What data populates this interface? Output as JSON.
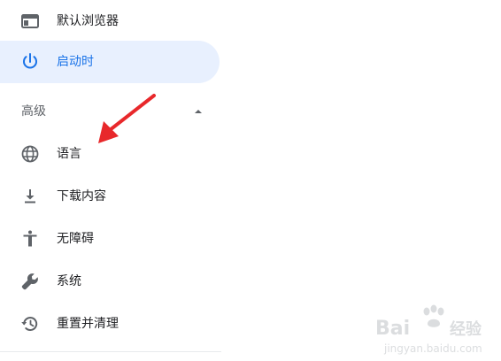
{
  "sidebar": {
    "items": [
      {
        "label": "默认浏览器",
        "icon": "browser-window-icon"
      },
      {
        "label": "启动时",
        "icon": "power-icon",
        "active": true
      },
      {
        "label": "语言",
        "icon": "globe-icon"
      },
      {
        "label": "下载内容",
        "icon": "download-icon"
      },
      {
        "label": "无障碍",
        "icon": "accessibility-icon"
      },
      {
        "label": "系统",
        "icon": "wrench-icon"
      },
      {
        "label": "重置并清理",
        "icon": "reset-history-icon"
      }
    ],
    "advanced_section": {
      "label": "高级",
      "expanded": true
    }
  },
  "watermark": {
    "brand": "Bai",
    "brand_suffix": "经验",
    "url": "jingyan.baidu.com"
  },
  "colors": {
    "accent": "#1a73e8",
    "active_bg": "#e8f0fe",
    "text": "#202124",
    "secondary_text": "#5f6368",
    "annotation_arrow": "#e8282b"
  }
}
